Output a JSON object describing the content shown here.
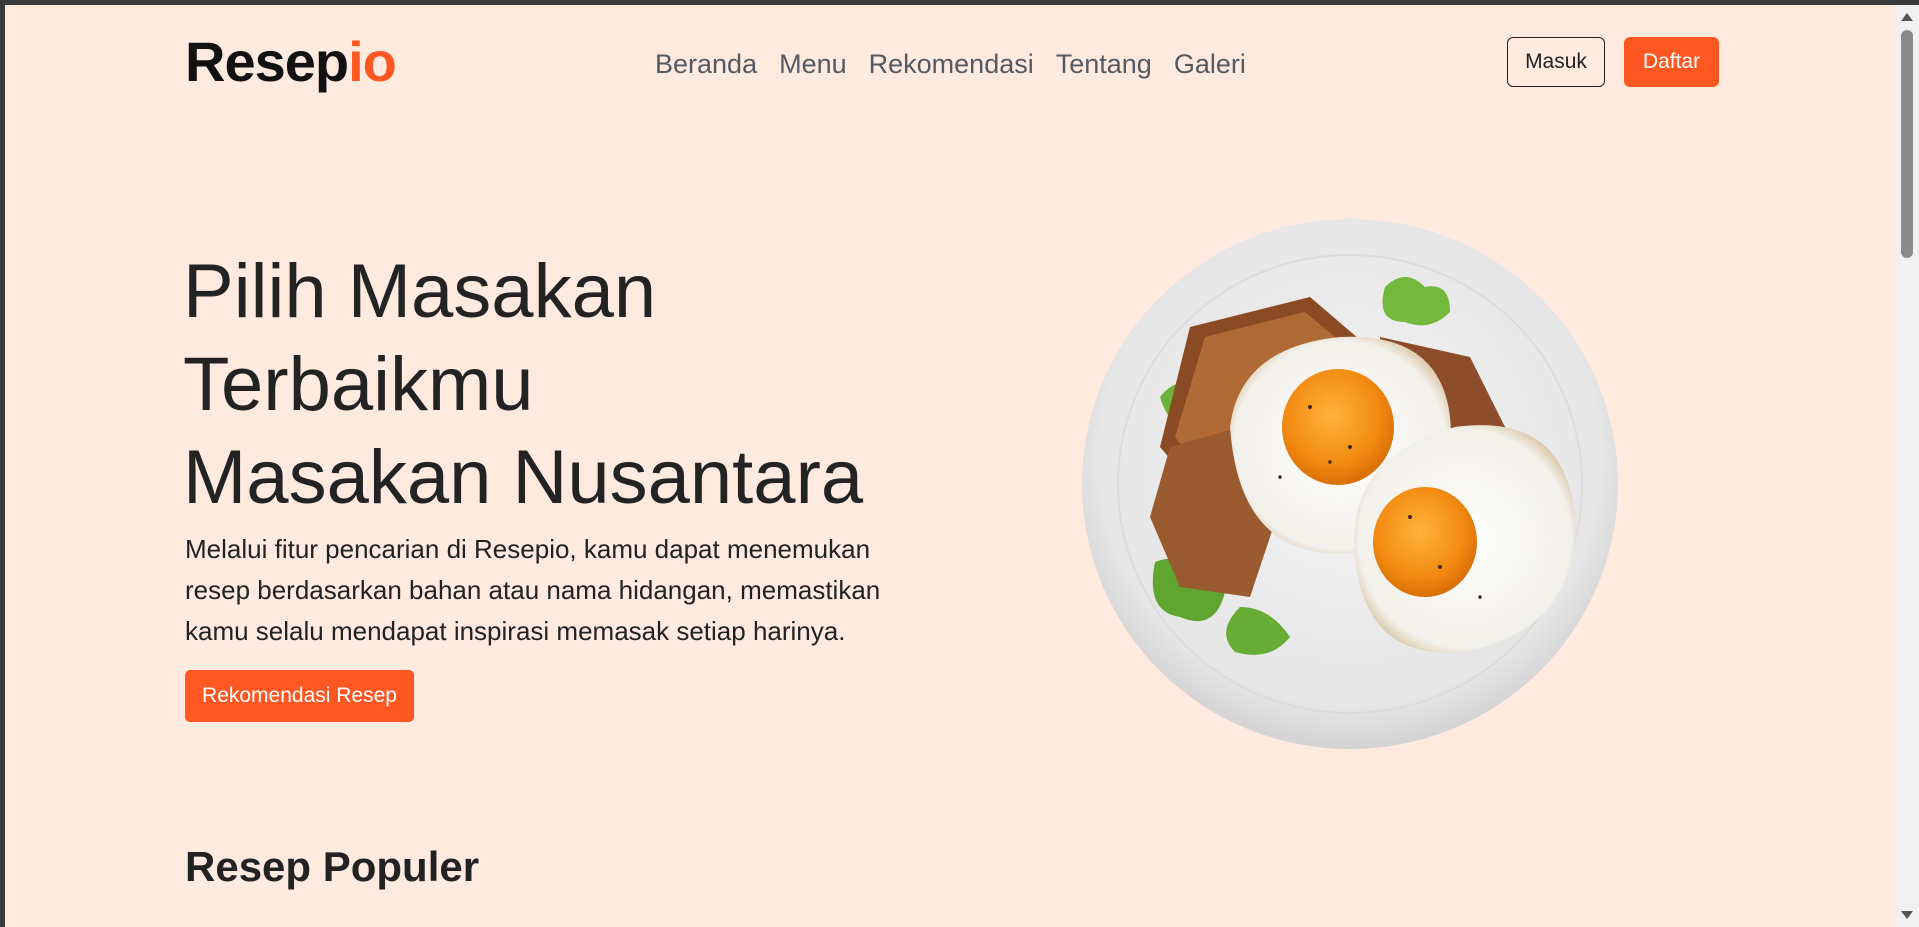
{
  "header": {
    "logo_main": "Resep",
    "logo_accent": "io",
    "nav": [
      "Beranda",
      "Menu",
      "Rekomendasi",
      "Tentang",
      "Galeri"
    ],
    "login_label": "Masuk",
    "register_label": "Daftar"
  },
  "hero": {
    "title_lines": [
      "Pilih Masakan",
      "Terbaikmu",
      "Masakan Nusantara"
    ],
    "description": "Melalui fitur pencarian di Resepio, kamu dapat menemukan resep berdasarkan bahan atau nama hidangan, memastikan kamu selalu mendapat inspirasi memasak setiap harinya.",
    "cta_label": "Rekomendasi Resep",
    "image_icon": "fried-egg-plate-image"
  },
  "popular": {
    "title": "Resep Populer"
  },
  "colors": {
    "accent": "#FF5722",
    "background": "#FFEAE0",
    "text": "#232323"
  }
}
